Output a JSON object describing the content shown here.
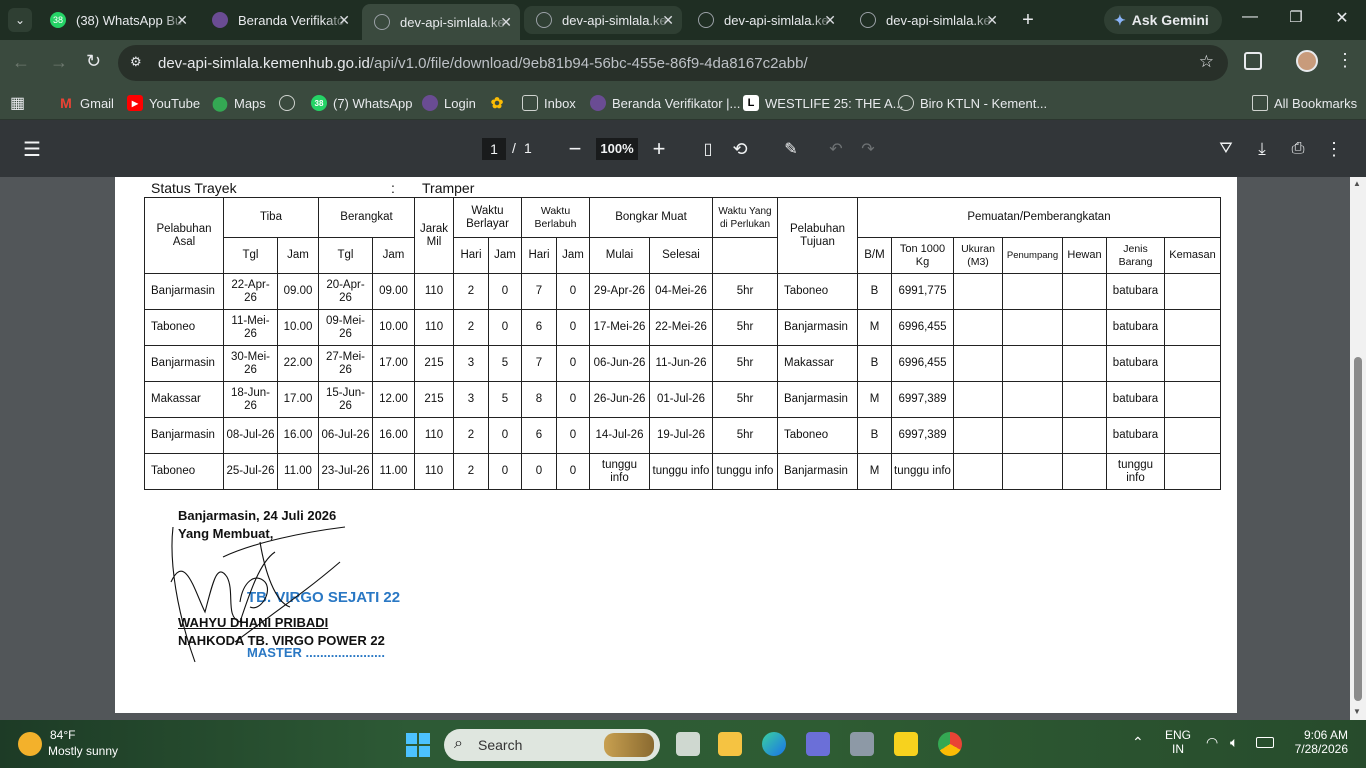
{
  "browser": {
    "tabs": [
      {
        "title": "(38) WhatsApp Bu",
        "favicon": "whatsapp-icon",
        "badge": "38",
        "color": "#25d366"
      },
      {
        "title": "Beranda Verifikato",
        "favicon": "globe-purple-icon",
        "color": "#6a4c93"
      },
      {
        "title": "dev-api-simlala.ke",
        "favicon": "globe-icon",
        "color": "#9aa0a6"
      },
      {
        "title": "dev-api-simlala.ke",
        "favicon": "globe-icon",
        "color": "#9aa0a6"
      },
      {
        "title": "dev-api-simlala.ke",
        "favicon": "globe-icon",
        "color": "#9aa0a6"
      },
      {
        "title": "dev-api-simlala.ke",
        "favicon": "globe-icon",
        "color": "#9aa0a6"
      }
    ],
    "ask_gemini": "Ask Gemini",
    "url_host": "dev-api-simlala.kemenhub.go.id",
    "url_path": "/api/v1.0/file/download/9eb81b94-56bc-455e-86f9-4da8167c2abb/",
    "bookmarks": [
      {
        "label": "Gmail",
        "icon": "gmail-icon",
        "color": "#ea4335"
      },
      {
        "label": "YouTube",
        "icon": "youtube-icon",
        "color": "#ff0000"
      },
      {
        "label": "Maps",
        "icon": "maps-icon",
        "color": "#34a853"
      },
      {
        "label": "",
        "icon": "globe-icon",
        "color": "#9aa0a6"
      },
      {
        "label": "(7) WhatsApp",
        "icon": "whatsapp-icon",
        "color": "#25d366"
      },
      {
        "label": "Login",
        "icon": "login-icon",
        "color": "#6a4c93"
      },
      {
        "label": "",
        "icon": "photos-icon",
        "color": "#fbbc05"
      },
      {
        "label": "Inbox",
        "icon": "inbox-icon",
        "color": "#9aa0a6"
      },
      {
        "label": "Beranda Verifikator |...",
        "icon": "globe-purple-icon",
        "color": "#6a4c93"
      },
      {
        "label": "WESTLIFE 25: THE A...",
        "icon": "l-icon",
        "color": "#ffffff"
      },
      {
        "label": "Biro KTLN - Kement...",
        "icon": "globe-icon",
        "color": "#9aa0a6"
      }
    ],
    "all_bookmarks": "All Bookmarks"
  },
  "pdf": {
    "page_current": "1",
    "page_sep": "/",
    "page_total": "1",
    "zoom": "100%"
  },
  "document": {
    "status_label": "Status Trayek",
    "status_colon": ":",
    "status_value": "Tramper",
    "headers": {
      "pelabuhan_asal": "Pelabuhan Asal",
      "tiba": "Tiba",
      "berangkat": "Berangkat",
      "jarak_mil": "Jarak Mil",
      "waktu_berlayar": "Waktu Berlayar",
      "waktu_berlabuh": "Waktu Berlabuh",
      "bongkar_muat": "Bongkar Muat",
      "waktu_diperlukan": "Waktu Yang di Perlukan",
      "pelabuhan_tujuan": "Pelabuhan Tujuan",
      "pemuatan": "Pemuatan/Pemberangkatan",
      "tgl": "Tgl",
      "jam": "Jam",
      "hari": "Hari",
      "mulai": "Mulai",
      "selesai": "Selesai",
      "bm": "B/M",
      "ton": "Ton 1000 Kg",
      "ukuran": "Ukuran (M3)",
      "penumpang": "Penumpang",
      "hewan": "Hewan",
      "jenis_barang": "Jenis Barang",
      "kemasan": "Kemasan"
    },
    "rows": [
      [
        "Banjarmasin",
        "22-Apr-26",
        "09.00",
        "20-Apr-26",
        "09.00",
        "110",
        "2",
        "0",
        "7",
        "0",
        "29-Apr-26",
        "04-Mei-26",
        "5hr",
        "Taboneo",
        "B",
        "6991,775",
        "",
        "",
        "",
        "batubara",
        ""
      ],
      [
        "Taboneo",
        "11-Mei-26",
        "10.00",
        "09-Mei-26",
        "10.00",
        "110",
        "2",
        "0",
        "6",
        "0",
        "17-Mei-26",
        "22-Mei-26",
        "5hr",
        "Banjarmasin",
        "M",
        "6996,455",
        "",
        "",
        "",
        "batubara",
        ""
      ],
      [
        "Banjarmasin",
        "30-Mei-26",
        "22.00",
        "27-Mei-26",
        "17.00",
        "215",
        "3",
        "5",
        "7",
        "0",
        "06-Jun-26",
        "11-Jun-26",
        "5hr",
        "Makassar",
        "B",
        "6996,455",
        "",
        "",
        "",
        "batubara",
        ""
      ],
      [
        "Makassar",
        "18-Jun-26",
        "17.00",
        "15-Jun-26",
        "12.00",
        "215",
        "3",
        "5",
        "8",
        "0",
        "26-Jun-26",
        "01-Jul-26",
        "5hr",
        "Banjarmasin",
        "M",
        "6997,389",
        "",
        "",
        "",
        "batubara",
        ""
      ],
      [
        "Banjarmasin",
        "08-Jul-26",
        "16.00",
        "06-Jul-26",
        "16.00",
        "110",
        "2",
        "0",
        "6",
        "0",
        "14-Jul-26",
        "19-Jul-26",
        "5hr",
        "Taboneo",
        "B",
        "6997,389",
        "",
        "",
        "",
        "batubara",
        ""
      ],
      [
        "Taboneo",
        "25-Jul-26",
        "11.00",
        "23-Jul-26",
        "11.00",
        "110",
        "2",
        "0",
        "0",
        "0",
        "tunggu info",
        "tunggu info",
        "tunggu info",
        "Banjarmasin",
        "M",
        "tunggu info",
        "",
        "",
        "",
        "tunggu info",
        ""
      ]
    ],
    "place_date": "Banjarmasin, 24 Juli 2026",
    "made_by": "Yang Membuat,",
    "stamp_name": "TB. VIRGO SEJATI 22",
    "signer_name": "WAHYU DHANI PRIBADI",
    "signer_title": "NAHKODA TB. VIRGO POWER 22",
    "stamp_master": "MASTER ......................"
  },
  "taskbar": {
    "weather_temp": "84°F",
    "weather_desc": "Mostly sunny",
    "search_placeholder": "Search",
    "lang": "ENG",
    "region": "IN",
    "time": "9:06 AM",
    "date": "7/28/2026"
  }
}
